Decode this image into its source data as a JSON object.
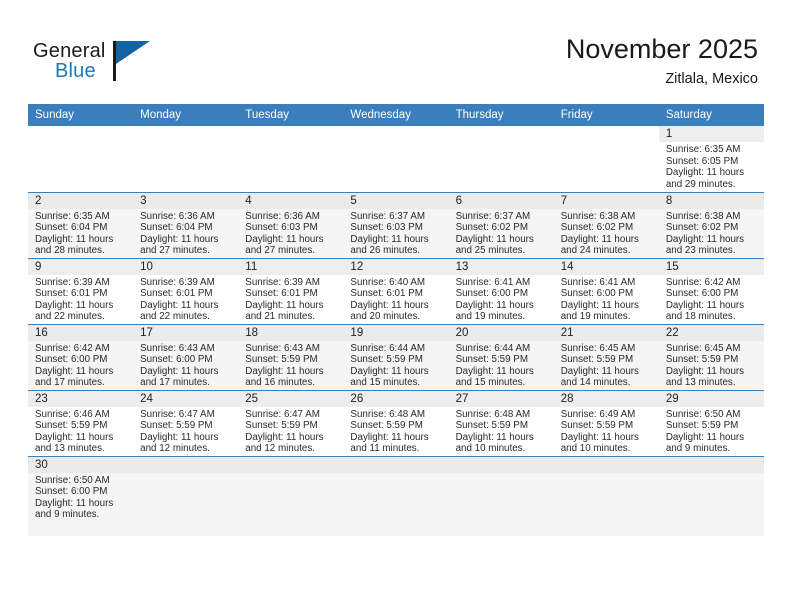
{
  "brand": {
    "name_part1": "General",
    "name_part2": "Blue",
    "logo_icon": "blue-triangle-icon"
  },
  "header": {
    "title": "November 2025",
    "location": "Zitlala, Mexico"
  },
  "colors": {
    "header_blue": "#3a7ebd",
    "brand_blue": "#1878c0",
    "row_shade": "#f5f5f5",
    "daynum_band": "#ededed"
  },
  "weekdays": [
    "Sunday",
    "Monday",
    "Tuesday",
    "Wednesday",
    "Thursday",
    "Friday",
    "Saturday"
  ],
  "labels": {
    "sunrise_prefix": "Sunrise: ",
    "sunset_prefix": "Sunset: ",
    "daylight_prefix": "Daylight: "
  },
  "weeks": [
    [
      {
        "day": "",
        "blank": true
      },
      {
        "day": "",
        "blank": true
      },
      {
        "day": "",
        "blank": true
      },
      {
        "day": "",
        "blank": true
      },
      {
        "day": "",
        "blank": true
      },
      {
        "day": "",
        "blank": true
      },
      {
        "day": "1",
        "sunrise": "Sunrise: 6:35 AM",
        "sunset": "Sunset: 6:05 PM",
        "daylight_line1": "Daylight: 11 hours",
        "daylight_line2": "and 29 minutes."
      }
    ],
    [
      {
        "day": "2",
        "sunrise": "Sunrise: 6:35 AM",
        "sunset": "Sunset: 6:04 PM",
        "daylight_line1": "Daylight: 11 hours",
        "daylight_line2": "and 28 minutes."
      },
      {
        "day": "3",
        "sunrise": "Sunrise: 6:36 AM",
        "sunset": "Sunset: 6:04 PM",
        "daylight_line1": "Daylight: 11 hours",
        "daylight_line2": "and 27 minutes."
      },
      {
        "day": "4",
        "sunrise": "Sunrise: 6:36 AM",
        "sunset": "Sunset: 6:03 PM",
        "daylight_line1": "Daylight: 11 hours",
        "daylight_line2": "and 27 minutes."
      },
      {
        "day": "5",
        "sunrise": "Sunrise: 6:37 AM",
        "sunset": "Sunset: 6:03 PM",
        "daylight_line1": "Daylight: 11 hours",
        "daylight_line2": "and 26 minutes."
      },
      {
        "day": "6",
        "sunrise": "Sunrise: 6:37 AM",
        "sunset": "Sunset: 6:02 PM",
        "daylight_line1": "Daylight: 11 hours",
        "daylight_line2": "and 25 minutes."
      },
      {
        "day": "7",
        "sunrise": "Sunrise: 6:38 AM",
        "sunset": "Sunset: 6:02 PM",
        "daylight_line1": "Daylight: 11 hours",
        "daylight_line2": "and 24 minutes."
      },
      {
        "day": "8",
        "sunrise": "Sunrise: 6:38 AM",
        "sunset": "Sunset: 6:02 PM",
        "daylight_line1": "Daylight: 11 hours",
        "daylight_line2": "and 23 minutes."
      }
    ],
    [
      {
        "day": "9",
        "sunrise": "Sunrise: 6:39 AM",
        "sunset": "Sunset: 6:01 PM",
        "daylight_line1": "Daylight: 11 hours",
        "daylight_line2": "and 22 minutes."
      },
      {
        "day": "10",
        "sunrise": "Sunrise: 6:39 AM",
        "sunset": "Sunset: 6:01 PM",
        "daylight_line1": "Daylight: 11 hours",
        "daylight_line2": "and 22 minutes."
      },
      {
        "day": "11",
        "sunrise": "Sunrise: 6:39 AM",
        "sunset": "Sunset: 6:01 PM",
        "daylight_line1": "Daylight: 11 hours",
        "daylight_line2": "and 21 minutes."
      },
      {
        "day": "12",
        "sunrise": "Sunrise: 6:40 AM",
        "sunset": "Sunset: 6:01 PM",
        "daylight_line1": "Daylight: 11 hours",
        "daylight_line2": "and 20 minutes."
      },
      {
        "day": "13",
        "sunrise": "Sunrise: 6:41 AM",
        "sunset": "Sunset: 6:00 PM",
        "daylight_line1": "Daylight: 11 hours",
        "daylight_line2": "and 19 minutes."
      },
      {
        "day": "14",
        "sunrise": "Sunrise: 6:41 AM",
        "sunset": "Sunset: 6:00 PM",
        "daylight_line1": "Daylight: 11 hours",
        "daylight_line2": "and 19 minutes."
      },
      {
        "day": "15",
        "sunrise": "Sunrise: 6:42 AM",
        "sunset": "Sunset: 6:00 PM",
        "daylight_line1": "Daylight: 11 hours",
        "daylight_line2": "and 18 minutes."
      }
    ],
    [
      {
        "day": "16",
        "sunrise": "Sunrise: 6:42 AM",
        "sunset": "Sunset: 6:00 PM",
        "daylight_line1": "Daylight: 11 hours",
        "daylight_line2": "and 17 minutes."
      },
      {
        "day": "17",
        "sunrise": "Sunrise: 6:43 AM",
        "sunset": "Sunset: 6:00 PM",
        "daylight_line1": "Daylight: 11 hours",
        "daylight_line2": "and 17 minutes."
      },
      {
        "day": "18",
        "sunrise": "Sunrise: 6:43 AM",
        "sunset": "Sunset: 5:59 PM",
        "daylight_line1": "Daylight: 11 hours",
        "daylight_line2": "and 16 minutes."
      },
      {
        "day": "19",
        "sunrise": "Sunrise: 6:44 AM",
        "sunset": "Sunset: 5:59 PM",
        "daylight_line1": "Daylight: 11 hours",
        "daylight_line2": "and 15 minutes."
      },
      {
        "day": "20",
        "sunrise": "Sunrise: 6:44 AM",
        "sunset": "Sunset: 5:59 PM",
        "daylight_line1": "Daylight: 11 hours",
        "daylight_line2": "and 15 minutes."
      },
      {
        "day": "21",
        "sunrise": "Sunrise: 6:45 AM",
        "sunset": "Sunset: 5:59 PM",
        "daylight_line1": "Daylight: 11 hours",
        "daylight_line2": "and 14 minutes."
      },
      {
        "day": "22",
        "sunrise": "Sunrise: 6:45 AM",
        "sunset": "Sunset: 5:59 PM",
        "daylight_line1": "Daylight: 11 hours",
        "daylight_line2": "and 13 minutes."
      }
    ],
    [
      {
        "day": "23",
        "sunrise": "Sunrise: 6:46 AM",
        "sunset": "Sunset: 5:59 PM",
        "daylight_line1": "Daylight: 11 hours",
        "daylight_line2": "and 13 minutes."
      },
      {
        "day": "24",
        "sunrise": "Sunrise: 6:47 AM",
        "sunset": "Sunset: 5:59 PM",
        "daylight_line1": "Daylight: 11 hours",
        "daylight_line2": "and 12 minutes."
      },
      {
        "day": "25",
        "sunrise": "Sunrise: 6:47 AM",
        "sunset": "Sunset: 5:59 PM",
        "daylight_line1": "Daylight: 11 hours",
        "daylight_line2": "and 12 minutes."
      },
      {
        "day": "26",
        "sunrise": "Sunrise: 6:48 AM",
        "sunset": "Sunset: 5:59 PM",
        "daylight_line1": "Daylight: 11 hours",
        "daylight_line2": "and 11 minutes."
      },
      {
        "day": "27",
        "sunrise": "Sunrise: 6:48 AM",
        "sunset": "Sunset: 5:59 PM",
        "daylight_line1": "Daylight: 11 hours",
        "daylight_line2": "and 10 minutes."
      },
      {
        "day": "28",
        "sunrise": "Sunrise: 6:49 AM",
        "sunset": "Sunset: 5:59 PM",
        "daylight_line1": "Daylight: 11 hours",
        "daylight_line2": "and 10 minutes."
      },
      {
        "day": "29",
        "sunrise": "Sunrise: 6:50 AM",
        "sunset": "Sunset: 5:59 PM",
        "daylight_line1": "Daylight: 11 hours",
        "daylight_line2": "and 9 minutes."
      }
    ],
    [
      {
        "day": "30",
        "sunrise": "Sunrise: 6:50 AM",
        "sunset": "Sunset: 6:00 PM",
        "daylight_line1": "Daylight: 11 hours",
        "daylight_line2": "and 9 minutes."
      },
      {
        "day": "",
        "blank": true
      },
      {
        "day": "",
        "blank": true
      },
      {
        "day": "",
        "blank": true
      },
      {
        "day": "",
        "blank": true
      },
      {
        "day": "",
        "blank": true
      },
      {
        "day": "",
        "blank": true
      }
    ]
  ]
}
